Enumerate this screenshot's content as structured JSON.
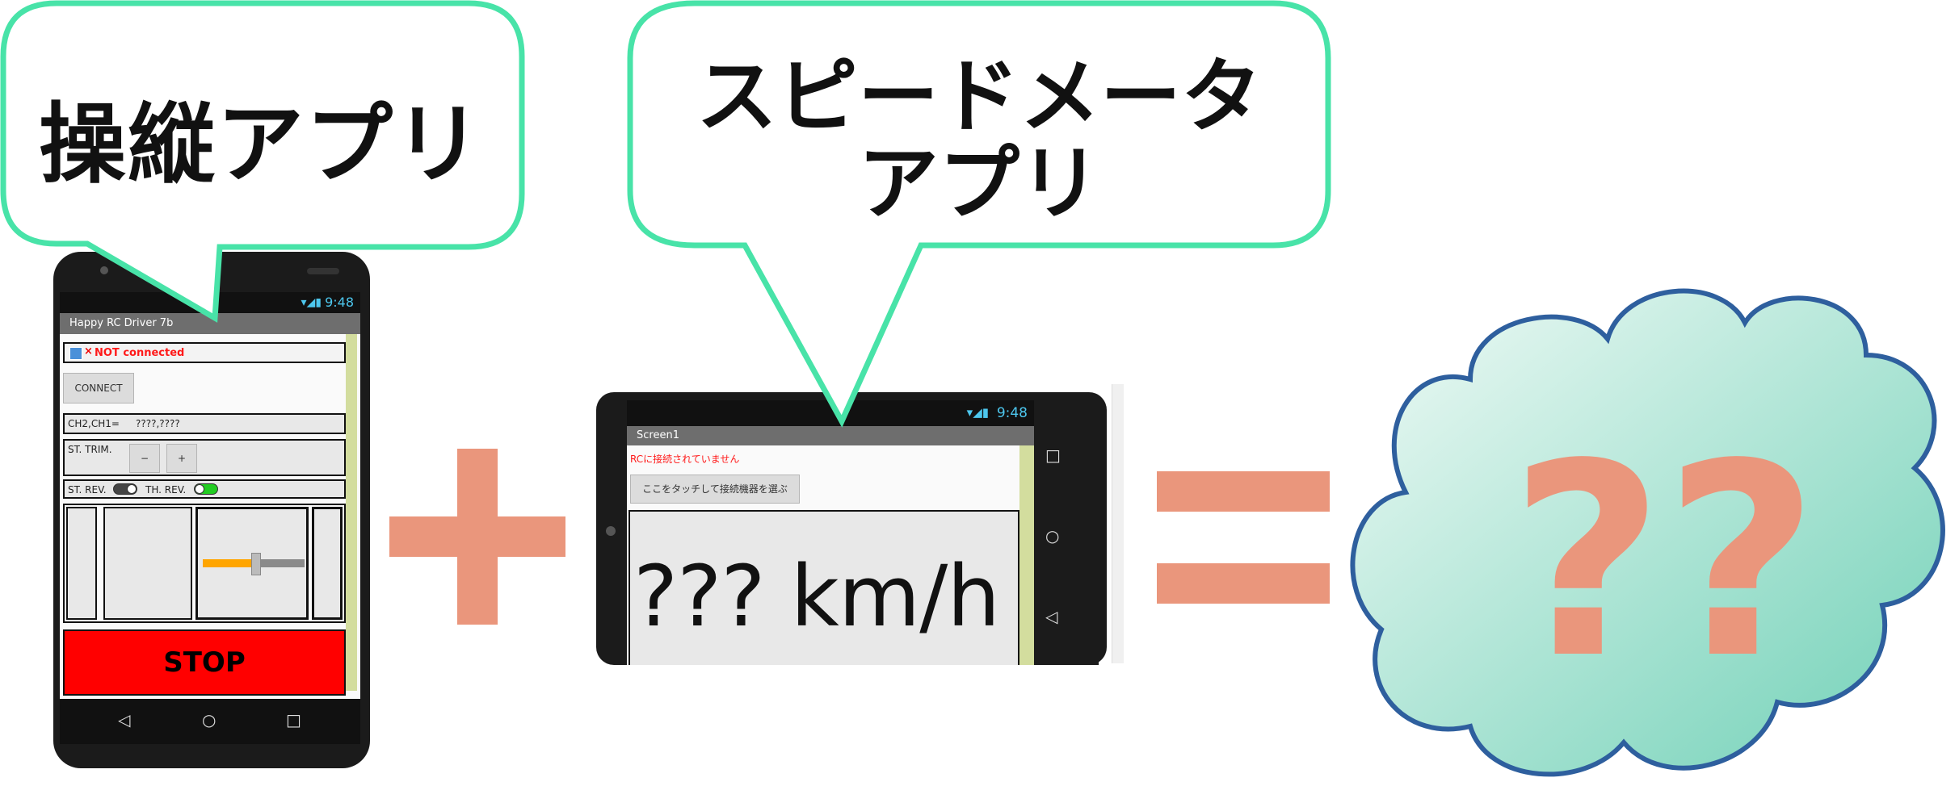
{
  "bubbles": {
    "control_app": "操縦アプリ",
    "speedometer_app": [
      "スピードメータ",
      "アプリ"
    ]
  },
  "phone1": {
    "status_time": "9:48",
    "app_title": "Happy RC Driver 7b",
    "connection_status": "NOT connected",
    "connect_button": "CONNECT",
    "channels_label": "CH2,CH1=",
    "channels_value": "????,????",
    "trim_label": "ST. TRIM.",
    "trim_minus": "−",
    "trim_plus": "+",
    "st_rev_label": "ST. REV.",
    "th_rev_label": "TH. REV.",
    "st_rev_on": false,
    "th_rev_on": true,
    "stop_button": "STOP"
  },
  "phone2": {
    "status_time": "9:48",
    "screen_title": "Screen1",
    "connection_status": "RCに接続されていません",
    "select_device_button": "ここをタッチして接続機器を選ぶ",
    "speed_readout": "??? km/h"
  },
  "equation": {
    "plus": "+",
    "equals": "=",
    "result": "??"
  },
  "colors": {
    "bubble_outline": "#48e3a8",
    "operator": "#ea967c",
    "cloud_outline": "#2e5f9e",
    "cloud_fill_top": "#e8f6f1",
    "cloud_fill_bottom": "#7dd5be",
    "not_connected": "#ff1a1a",
    "stop": "#ff0000",
    "toggle_on": "#22cc22",
    "slider_fill": "#ffa500"
  }
}
